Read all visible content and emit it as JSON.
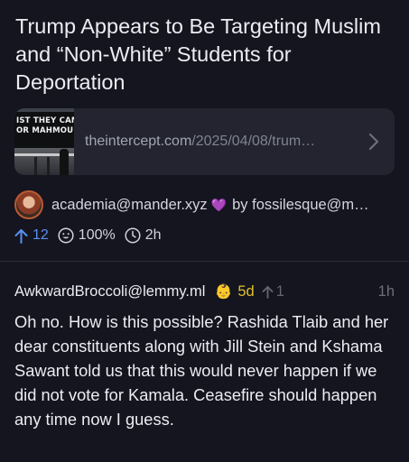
{
  "post": {
    "title": "Trump Appears to Be Targeting Muslim and “Non-White” Students for Deportation",
    "link": {
      "thumbnail_sign_line1": "IST THEY CAME",
      "thumbnail_sign_line2": "OR MAHMOUD",
      "domain": "theintercept.com",
      "path": "/2025/04/08/trum…"
    },
    "community": "academia@mander.xyz",
    "community_badge": "💜",
    "by_label": "by fossilesque@m…",
    "score": "12",
    "upvote_pct": "100%",
    "age": "2h"
  },
  "comment": {
    "author": "AwkwardBroccoli@lemmy.ml",
    "new_account_icon": "baby-icon",
    "account_age": "5d",
    "score": "1",
    "time": "1h",
    "body": "Oh no. How is this possible? Rashida Tlaib and her dear constituents along with Jill Stein and Kshama Sawant told us that this would never happen if we did not vote for Kamala. Ceasefire should happen any time now I guess."
  },
  "colors": {
    "background": "#14151f",
    "card": "#23242f",
    "upvote_accent": "#5a8ff0",
    "account_age": "#e2c12c"
  }
}
